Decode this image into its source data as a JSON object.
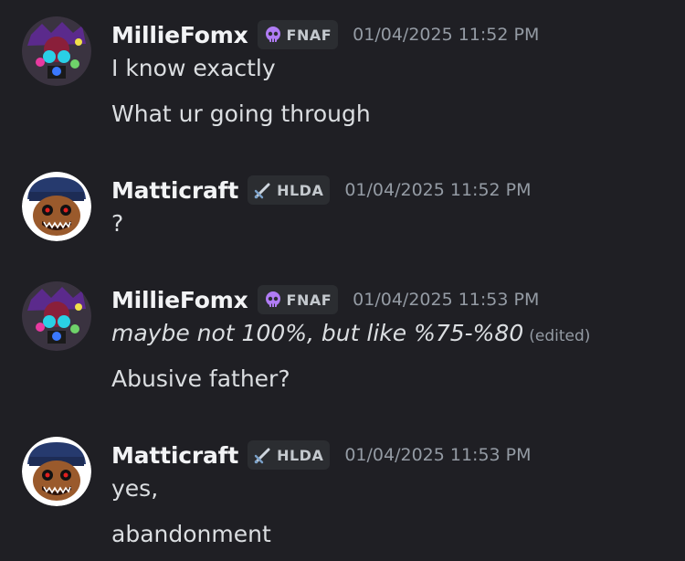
{
  "messages": [
    {
      "username": "MillieFomx",
      "tag": {
        "label": "FNAF",
        "icon": "skull-icon"
      },
      "timestamp": "01/04/2025 11:52 PM",
      "lines": [
        "I know exactly",
        "What ur going through"
      ]
    },
    {
      "username": "Matticraft",
      "tag": {
        "label": "HLDA",
        "icon": "sword-icon"
      },
      "timestamp": "01/04/2025 11:52 PM",
      "lines": [
        "?"
      ]
    },
    {
      "username": "MillieFomx",
      "tag": {
        "label": "FNAF",
        "icon": "skull-icon"
      },
      "timestamp": "01/04/2025 11:53 PM",
      "lines": [
        "maybe not 100%, but like %75-%80",
        "Abusive father?"
      ],
      "edited_label": "(edited)"
    },
    {
      "username": "Matticraft",
      "tag": {
        "label": "HLDA",
        "icon": "sword-icon"
      },
      "timestamp": "01/04/2025 11:53 PM",
      "lines": [
        "yes,",
        "abandonment"
      ]
    }
  ],
  "colors": {
    "background": "#1f1f24",
    "username": "#f2f3f5",
    "message_text": "#dbdee1",
    "timestamp": "#949ba4",
    "tag_bg": "#2b2d31",
    "skull": "#b07cf5"
  }
}
